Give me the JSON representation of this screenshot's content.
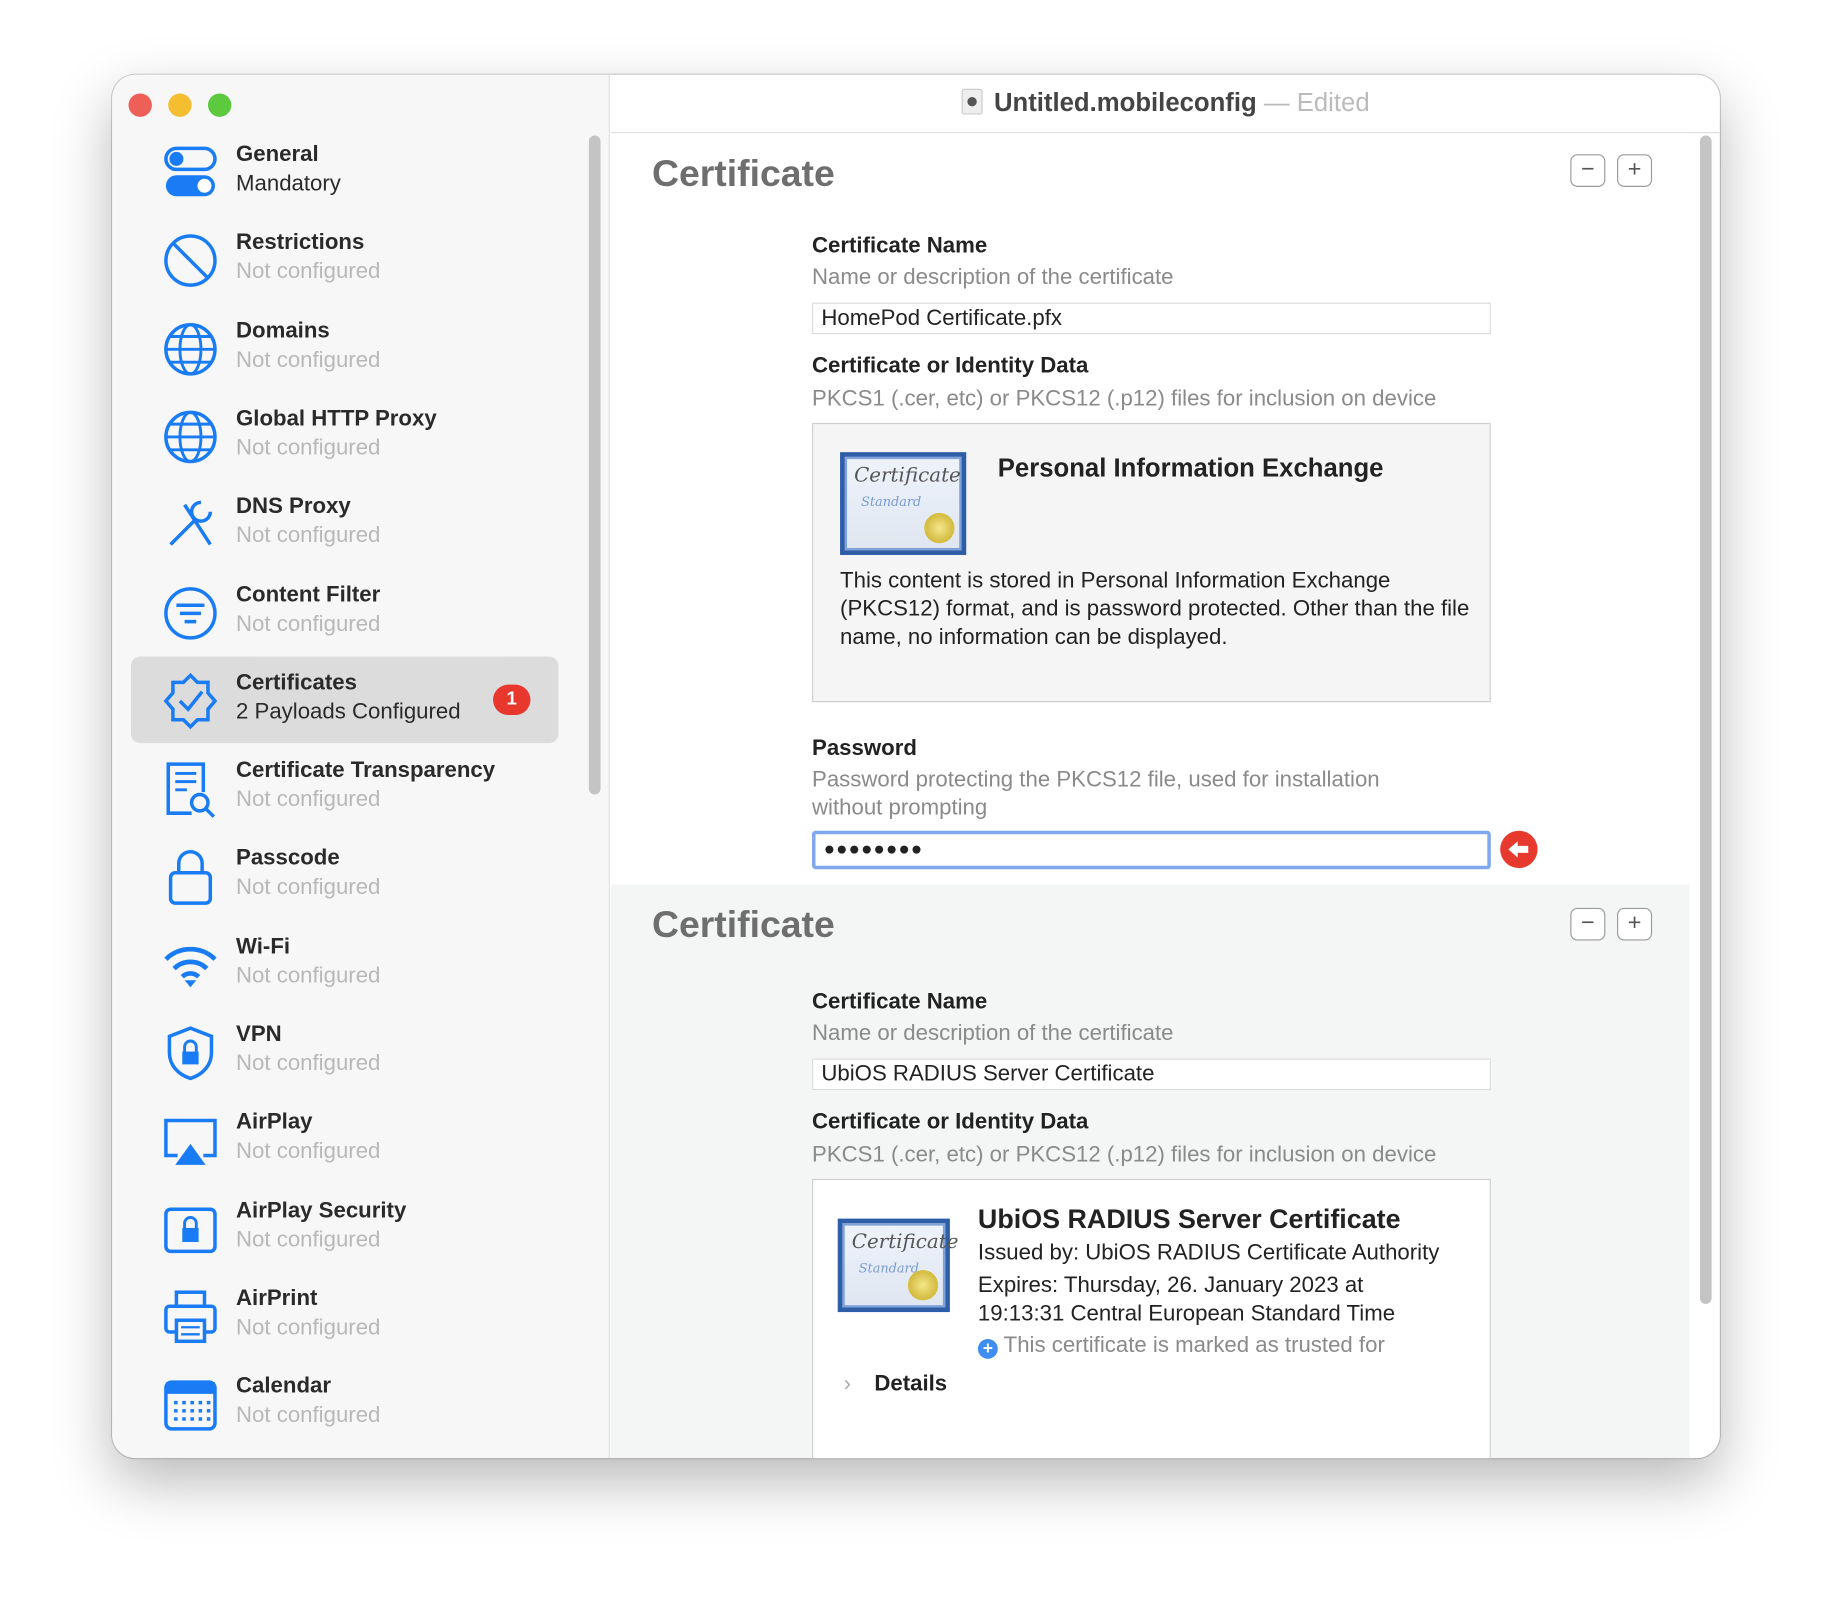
{
  "window": {
    "filename": "Untitled.mobileconfig",
    "separator": "—",
    "status": "Edited"
  },
  "sidebar": {
    "items": [
      {
        "title": "General",
        "subtitle": "Mandatory",
        "icon": "toggle-icon"
      },
      {
        "title": "Restrictions",
        "subtitle": "Not configured",
        "icon": "prohibited-icon"
      },
      {
        "title": "Domains",
        "subtitle": "Not configured",
        "icon": "globe-icon"
      },
      {
        "title": "Global HTTP Proxy",
        "subtitle": "Not configured",
        "icon": "globe-icon"
      },
      {
        "title": "DNS Proxy",
        "subtitle": "Not configured",
        "icon": "tools-icon"
      },
      {
        "title": "Content Filter",
        "subtitle": "Not configured",
        "icon": "filter-icon"
      },
      {
        "title": "Certificates",
        "subtitle": "2 Payloads Configured",
        "icon": "certificate-badge-icon",
        "badge": "1"
      },
      {
        "title": "Certificate Transparency",
        "subtitle": "Not configured",
        "icon": "document-search-icon"
      },
      {
        "title": "Passcode",
        "subtitle": "Not configured",
        "icon": "lock-icon"
      },
      {
        "title": "Wi-Fi",
        "subtitle": "Not configured",
        "icon": "wifi-icon"
      },
      {
        "title": "VPN",
        "subtitle": "Not configured",
        "icon": "shield-lock-icon"
      },
      {
        "title": "AirPlay",
        "subtitle": "Not configured",
        "icon": "airplay-icon"
      },
      {
        "title": "AirPlay Security",
        "subtitle": "Not configured",
        "icon": "lock-screen-icon"
      },
      {
        "title": "AirPrint",
        "subtitle": "Not configured",
        "icon": "printer-icon"
      },
      {
        "title": "Calendar",
        "subtitle": "Not configured",
        "icon": "calendar-icon"
      }
    ]
  },
  "payloads": [
    {
      "heading": "Certificate",
      "remove": "−",
      "add": "+",
      "name_label": "Certificate Name",
      "name_desc": "Name or description of the certificate",
      "name_value": "HomePod Certificate.pfx",
      "data_label": "Certificate or Identity Data",
      "data_desc": "PKCS1 (.cer, etc) or PKCS12 (.p12) files for inclusion on device",
      "cert_title": "Personal Information Exchange",
      "cert_body": "This content is stored in Personal Information Exchange (PKCS12) format, and is password protected.  Other than the file name, no information can be displayed.",
      "password_label": "Password",
      "password_desc": "Password protecting the PKCS12 file, used for installation without prompting",
      "password_value": "●●●●●●●●"
    },
    {
      "heading": "Certificate",
      "remove": "−",
      "add": "+",
      "name_label": "Certificate Name",
      "name_desc": "Name or description of the certificate",
      "name_value": "UbiOS RADIUS Server Certificate",
      "data_label": "Certificate or Identity Data",
      "data_desc": "PKCS1 (.cer, etc) or PKCS12 (.p12) files for inclusion on device",
      "cert_title": "UbiOS RADIUS Server Certificate",
      "issued": "Issued by: UbiOS RADIUS Certificate Authority",
      "expires": "Expires: Thursday, 26. January 2023 at 19:13:31 Central European Standard Time",
      "trust": "This certificate is marked as trusted for",
      "details": "Details"
    }
  ],
  "cert_art": {
    "line1": "Certificate",
    "line2": "Standard"
  },
  "colors": {
    "accent": "#1a7cf5",
    "badge": "#e8382d",
    "selected": "#dcdcdc"
  }
}
